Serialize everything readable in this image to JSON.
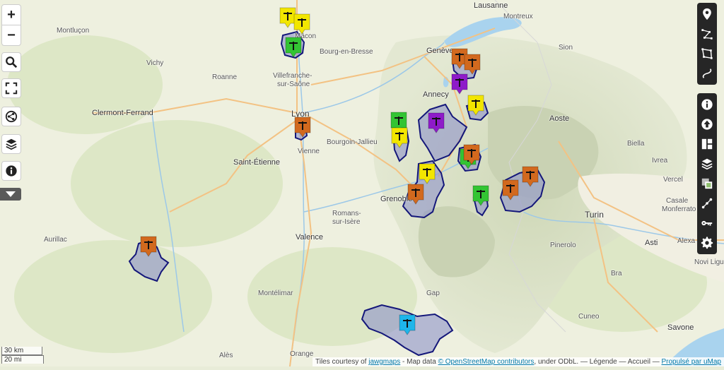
{
  "controls": {
    "zoom_in": "+",
    "zoom_out": "−",
    "search_icon": "search-icon",
    "fullscreen_icon": "fullscreen-icon",
    "share_icon": "share-icon",
    "layers_icon": "layers-icon",
    "info_icon": "info-icon",
    "collapse_icon": "chevron-down-icon"
  },
  "edit_toolbar": {
    "icons": [
      "marker-icon",
      "polyline-icon",
      "polygon-icon",
      "route-icon"
    ]
  },
  "settings_toolbar": {
    "icons": [
      "info-icon",
      "upload-icon",
      "layout-icon",
      "layers-icon",
      "tiles-icon",
      "cluster-icon",
      "key-icon",
      "gear-icon"
    ]
  },
  "scale": {
    "metric": "30 km",
    "imperial": "20 mi"
  },
  "attribution": {
    "prefix": "Tiles courtesy of ",
    "tile_link": "jawgmaps",
    "middle": " - Map data ",
    "osm_link": "© OpenStreetMap contributors",
    "suffix": ", under ODbL. — Légende — Accueil — ",
    "umap_link": "Propulsé par uMap"
  },
  "places": [
    {
      "name": "Lausanne",
      "cls": "city"
    },
    {
      "name": "Montreux",
      "cls": ""
    },
    {
      "name": "Montluçon",
      "cls": ""
    },
    {
      "name": "Mâcon",
      "cls": ""
    },
    {
      "name": "Bourg-en-Bresse",
      "cls": ""
    },
    {
      "name": "Genève",
      "cls": "city"
    },
    {
      "name": "Sion",
      "cls": ""
    },
    {
      "name": "Vichy",
      "cls": ""
    },
    {
      "name": "Roanne",
      "cls": ""
    },
    {
      "name": "Villefranche-",
      "cls": ""
    },
    {
      "name": "sur-Saône",
      "cls": ""
    },
    {
      "name": "Annecy",
      "cls": "city"
    },
    {
      "name": "Clermont-Ferrand",
      "cls": "city"
    },
    {
      "name": "Lyon",
      "cls": "big"
    },
    {
      "name": "Aoste",
      "cls": "city"
    },
    {
      "name": "Bourgoin-Jallieu",
      "cls": ""
    },
    {
      "name": "Biella",
      "cls": ""
    },
    {
      "name": "Saint-Étienne",
      "cls": "city"
    },
    {
      "name": "Vienne",
      "cls": ""
    },
    {
      "name": "Ivrea",
      "cls": ""
    },
    {
      "name": "Vercel",
      "cls": ""
    },
    {
      "name": "Grenoble",
      "cls": "city"
    },
    {
      "name": "Casale",
      "cls": ""
    },
    {
      "name": "Monferrato",
      "cls": ""
    },
    {
      "name": "Turin",
      "cls": "big"
    },
    {
      "name": "Romans-",
      "cls": ""
    },
    {
      "name": "sur-Isère",
      "cls": ""
    },
    {
      "name": "Valence",
      "cls": "city"
    },
    {
      "name": "Aurillac",
      "cls": ""
    },
    {
      "name": "Pinerolo",
      "cls": ""
    },
    {
      "name": "Asti",
      "cls": "city"
    },
    {
      "name": "Alexa",
      "cls": ""
    },
    {
      "name": "Novi Ligure",
      "cls": ""
    },
    {
      "name": "Bra",
      "cls": ""
    },
    {
      "name": "Montélimar",
      "cls": ""
    },
    {
      "name": "Gap",
      "cls": ""
    },
    {
      "name": "Cuneo",
      "cls": ""
    },
    {
      "name": "Savone",
      "cls": "city"
    },
    {
      "name": "Orange",
      "cls": ""
    },
    {
      "name": "Alès",
      "cls": ""
    }
  ],
  "colors": {
    "orange": "#d2691e",
    "yellow": "#f2e600",
    "green": "#33c433",
    "purple": "#8e1bc9",
    "cyan": "#1eb5ea",
    "polygon_fill": "#8e93c9",
    "polygon_stroke": "#14177a"
  },
  "markers": [
    {
      "color": "yellow",
      "icon": "marker-pictogram-icon"
    },
    {
      "color": "yellow",
      "icon": "marker-pictogram-icon"
    },
    {
      "color": "green",
      "icon": "marker-pictogram-icon"
    },
    {
      "color": "orange",
      "icon": "marker-pictogram-icon"
    },
    {
      "color": "green",
      "icon": "marker-pictogram-icon"
    },
    {
      "color": "yellow",
      "icon": "marker-pictogram-icon"
    },
    {
      "color": "purple",
      "icon": "marker-pictogram-icon"
    },
    {
      "color": "orange",
      "icon": "marker-pictogram-icon"
    },
    {
      "color": "orange",
      "icon": "marker-pictogram-icon"
    },
    {
      "color": "purple",
      "icon": "marker-pictogram-icon"
    },
    {
      "color": "yellow",
      "icon": "marker-pictogram-icon"
    },
    {
      "color": "green",
      "icon": "marker-pictogram-icon"
    },
    {
      "color": "orange",
      "icon": "marker-pictogram-icon"
    },
    {
      "color": "yellow",
      "icon": "marker-pictogram-icon"
    },
    {
      "color": "orange",
      "icon": "marker-pictogram-icon"
    },
    {
      "color": "green",
      "icon": "marker-pictogram-icon"
    },
    {
      "color": "orange",
      "icon": "marker-pictogram-icon"
    },
    {
      "color": "orange",
      "icon": "marker-pictogram-icon"
    },
    {
      "color": "orange",
      "icon": "marker-pictogram-icon"
    },
    {
      "color": "cyan",
      "icon": "marker-pictogram-icon"
    }
  ]
}
